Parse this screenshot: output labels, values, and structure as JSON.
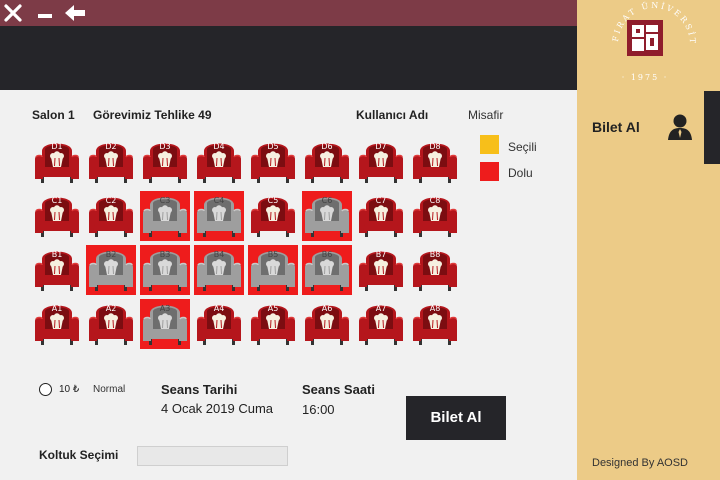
{
  "titlebar": {
    "close_icon": "close-icon",
    "minimize_icon": "minimize-icon",
    "back_icon": "back-arrow-icon"
  },
  "info": {
    "hall": "Salon 1",
    "movie": "Görevimiz Tehlike 49",
    "username_label": "Kullanıcı Adı",
    "username": "Misafir"
  },
  "legend": {
    "selected_label": "Seçili",
    "selected_color": "#f7bf1a",
    "occupied_label": "Dolu",
    "occupied_color": "#ee1c1c"
  },
  "seats": [
    {
      "row": "D",
      "items": [
        {
          "id": "D1",
          "taken": false
        },
        {
          "id": "D2",
          "taken": false
        },
        {
          "id": "D3",
          "taken": false
        },
        {
          "id": "D4",
          "taken": false
        },
        {
          "id": "D5",
          "taken": false
        },
        {
          "id": "D6",
          "taken": false
        },
        {
          "id": "D7",
          "taken": false
        },
        {
          "id": "D8",
          "taken": false
        }
      ]
    },
    {
      "row": "C",
      "items": [
        {
          "id": "C1",
          "taken": false
        },
        {
          "id": "C2",
          "taken": false
        },
        {
          "id": "C3",
          "taken": true
        },
        {
          "id": "C4",
          "taken": true
        },
        {
          "id": "C5",
          "taken": false
        },
        {
          "id": "C6",
          "taken": true
        },
        {
          "id": "C7",
          "taken": false
        },
        {
          "id": "C8",
          "taken": false
        }
      ]
    },
    {
      "row": "B",
      "items": [
        {
          "id": "B1",
          "taken": false
        },
        {
          "id": "B2",
          "taken": true
        },
        {
          "id": "B3",
          "taken": true
        },
        {
          "id": "B4",
          "taken": true
        },
        {
          "id": "B5",
          "taken": true
        },
        {
          "id": "B6",
          "taken": true
        },
        {
          "id": "B7",
          "taken": false
        },
        {
          "id": "B8",
          "taken": false
        }
      ]
    },
    {
      "row": "A",
      "items": [
        {
          "id": "A1",
          "taken": false
        },
        {
          "id": "A2",
          "taken": false
        },
        {
          "id": "A3",
          "taken": true
        },
        {
          "id": "A4",
          "taken": false
        },
        {
          "id": "A5",
          "taken": false
        },
        {
          "id": "A6",
          "taken": false
        },
        {
          "id": "A7",
          "taken": false
        },
        {
          "id": "A8",
          "taken": false
        }
      ]
    }
  ],
  "ticket": {
    "price": "10 ₺",
    "type": "Normal",
    "date_label": "Seans Tarihi",
    "date_value": "4 Ocak 2019 Cuma",
    "time_label": "Seans Saati",
    "time_value": "16:00",
    "buy_button": "Bilet Al",
    "seat_select_label": "Koltuk Seçimi",
    "seat_select_value": ""
  },
  "sidebar": {
    "logo_text": "FIRAT ÜNİVERSİTESİ",
    "logo_year": "1975",
    "buy_label": "Bilet Al",
    "user_icon": "user-icon",
    "credit": "Designed By AOSD"
  }
}
